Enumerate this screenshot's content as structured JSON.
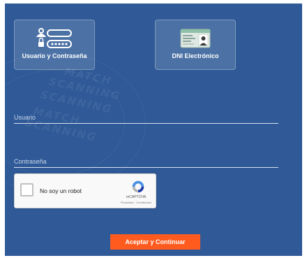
{
  "login_methods": {
    "user_password_label": "Usuario y Contraseña",
    "dni_label": "DNI Electrónico"
  },
  "form": {
    "usuario_label": "Usuario",
    "password_label": "Contraseña"
  },
  "captcha": {
    "label": "No soy un robot",
    "brand": "reCAPTCHA",
    "links": "Privacidad - Condiciones"
  },
  "submit_label": "Aceptar y Continuar",
  "background_text": [
    "MATCH",
    "SCANNING",
    "SCANNING",
    "MATCH",
    "SCANNING"
  ],
  "colors": {
    "panel": "#2f5a97",
    "accent": "#ff5b1f"
  }
}
